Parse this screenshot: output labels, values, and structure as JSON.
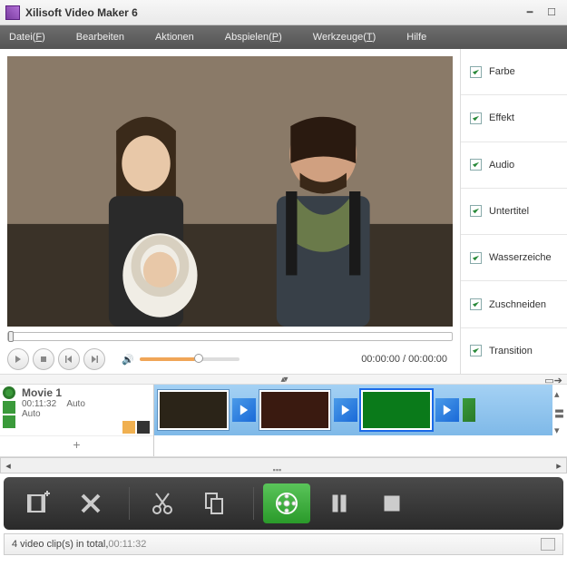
{
  "window": {
    "title": "Xilisoft Video Maker 6"
  },
  "menu": {
    "file": "Datei(F)",
    "edit": "Bearbeiten",
    "actions": "Aktionen",
    "play": "Abspielen(P)",
    "tools": "Werkzeuge(T)",
    "help": "Hilfe"
  },
  "side": {
    "color": "Farbe",
    "effect": "Effekt",
    "audio": "Audio",
    "subtitle": "Untertitel",
    "watermark": "Wasserzeiche",
    "crop": "Zuschneiden",
    "transition": "Transition"
  },
  "preview": {
    "time": "00:00:00 / 00:00:00"
  },
  "timeline": {
    "name": "Movie 1",
    "duration": "00:11:32",
    "mode": "Auto",
    "mode2": "Auto"
  },
  "status": {
    "text_a": "4 video clip(s) in total, ",
    "text_b": "00:11:32"
  },
  "icons": {
    "play": "play",
    "stop": "stop",
    "prev": "prev",
    "next": "next",
    "speaker": "speaker",
    "add": "+",
    "grip": "≡"
  }
}
